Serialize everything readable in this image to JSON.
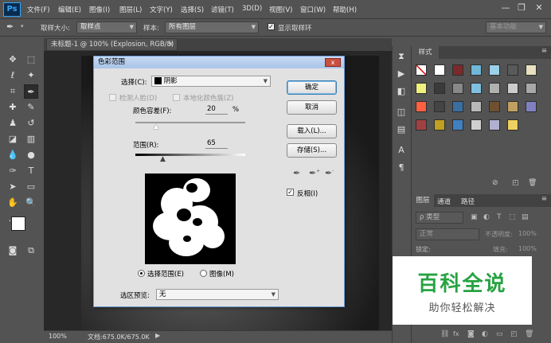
{
  "app": {
    "logo": "Ps"
  },
  "menu": [
    "文件(F)",
    "编辑(E)",
    "图像(I)",
    "图层(L)",
    "文字(Y)",
    "选择(S)",
    "滤镜(T)",
    "3D(D)",
    "视图(V)",
    "窗口(W)",
    "帮助(H)"
  ],
  "window_controls": {
    "minimize": "—",
    "restore": "❐",
    "close": "✕"
  },
  "options": {
    "sample_size_label": "取样大小:",
    "sample_size_value": "取样点",
    "sample_label": "样本:",
    "sample_value": "所有图层",
    "show_ring_label": "显示取样环",
    "show_ring_checked": true,
    "workspace": "基本功能"
  },
  "document": {
    "tab_title": "未标题-1 @ 100% (Explosion, RGB/8) *",
    "tab_close": "×",
    "zoom": "100%",
    "doc_size": "文档:675.0K/675.0K"
  },
  "dialog": {
    "title": "色彩范围",
    "close": "x",
    "select_label": "选择(C):",
    "select_value": "阴影",
    "detect_faces_label": "检测人脸(D)",
    "localized_label": "本地化颜色簇(Z)",
    "fuzziness_label": "颜色容差(F):",
    "fuzziness_value": "20",
    "fuzziness_unit": "%",
    "range_label": "范围(R):",
    "range_value": "65",
    "ok": "确定",
    "cancel": "取消",
    "load": "载入(L)...",
    "save": "存储(S)...",
    "invert_label": "反相(I)",
    "invert_checked": true,
    "selection_radio": "选择范围(E)",
    "image_radio": "图像(M)",
    "preview_label": "选区预览:",
    "preview_value": "无",
    "eyedropper_icons": [
      "eyedropper-icon",
      "eyedropper-plus-icon",
      "eyedropper-minus-icon"
    ]
  },
  "panels": {
    "styles_tab": "样式",
    "layers_tabs": [
      "图层",
      "通道",
      "路径"
    ],
    "kind_label": "ρ 类型",
    "blend_mode": "正常",
    "opacity_label": "不透明度:",
    "opacity_value": "100%",
    "lock_label": "锁定:",
    "fill_label": "填充:",
    "fill_value": "100%"
  },
  "watermark": {
    "title": "百科全说",
    "subtitle": "助你轻松解决"
  },
  "swatch_colors": [
    "#ffffff",
    "#7a2a2a",
    "#6fb8d8",
    "#9ad0e8",
    "#5a5a5a",
    "#e8e0c0",
    "#f0f080",
    "#3a3a3a",
    "#888888",
    "#80c0e0",
    "#b0b0b0",
    "#cccccc",
    "#a8a8a8",
    "#ff6040",
    "#444444",
    "#3a6ea0",
    "#b8b8b8",
    "#705030",
    "#c0a060",
    "#8080c0",
    "#a04040",
    "#c0a020",
    "#4080c0",
    "#d0d0d0",
    "#b0b0d0",
    "#f0d060"
  ]
}
